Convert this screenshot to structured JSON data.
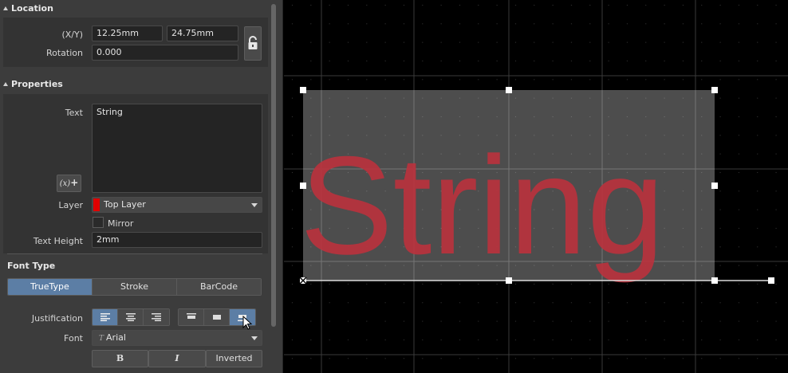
{
  "location": {
    "header": "Location",
    "xy_label": "(X/Y)",
    "x_value": "12.25mm",
    "y_value": "24.75mm",
    "rotation_label": "Rotation",
    "rotation_value": "0.000"
  },
  "properties": {
    "header": "Properties",
    "text_label": "Text",
    "text_value": "String",
    "layer_label": "Layer",
    "layer_value": "Top Layer",
    "layer_color": "#e00000",
    "mirror_label": "Mirror",
    "text_height_label": "Text Height",
    "text_height_value": "2mm"
  },
  "font_type": {
    "header": "Font Type",
    "tabs": [
      "TrueType",
      "Stroke",
      "BarCode"
    ],
    "active_tab": "TrueType",
    "justification_label": "Justification",
    "font_label": "Font",
    "font_value": "Arial",
    "bold_label": "B",
    "italic_label": "I",
    "inverted_label": "Inverted"
  },
  "canvas": {
    "text": "String",
    "text_color": "#b8323d",
    "background": "#000000"
  }
}
